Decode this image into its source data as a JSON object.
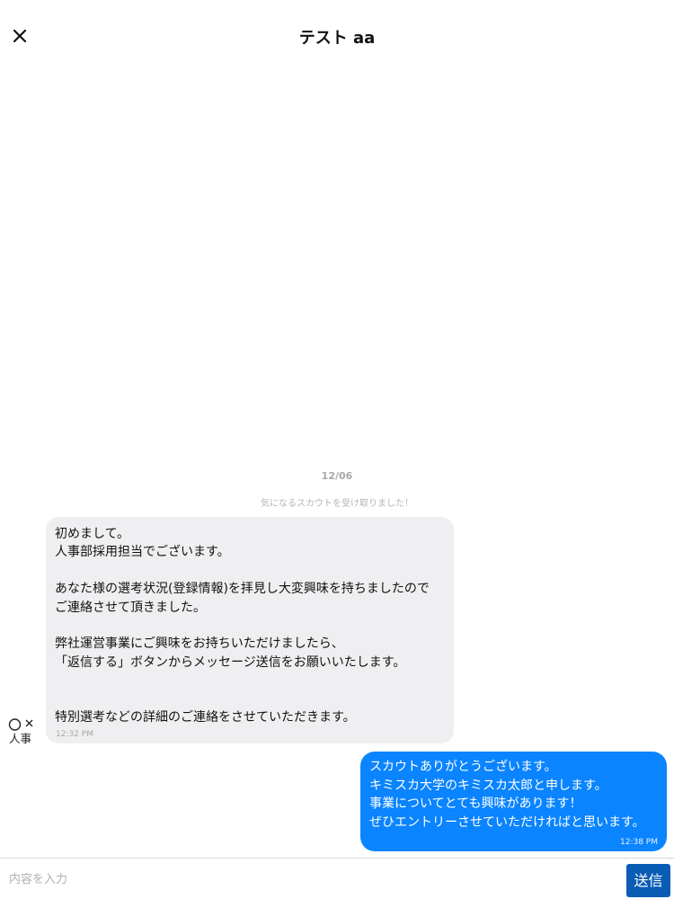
{
  "header": {
    "title": "テスト aa",
    "close_icon": "close-icon"
  },
  "thread": {
    "date": "12/06",
    "notice": "気になるスカウトを受け取りました！",
    "avatar": {
      "icon": "company-avatar-icon",
      "text": "人事"
    },
    "messages": [
      {
        "direction": "incoming",
        "text": "初めまして。\n人事部採用担当でございます。\n\nあなた様の選考状況(登録情報)を拝見し大変興味を持ちましたので\nご連絡させて頂きました。\n\n弊社運営事業にご興味をお持ちいただけましたら、\n「返信する」ボタンからメッセージ送信をお願いいたします。\n\n\n特別選考などの詳細のご連絡をさせていただきます。",
        "time": "12:32 PM"
      },
      {
        "direction": "outgoing",
        "text": "スカウトありがとうございます。\nキミスカ大学のキミスカ太郎と申します。\n事業についてとても興味があります！\nぜひエントリーさせていただければと思います。",
        "time": "12:38 PM"
      }
    ]
  },
  "composer": {
    "placeholder": "内容を入力",
    "value": "",
    "send_label": "送信"
  },
  "colors": {
    "outgoing_bubble": "#0a84ff",
    "incoming_bubble": "#efeff1",
    "send_button": "#0b5cb5"
  }
}
